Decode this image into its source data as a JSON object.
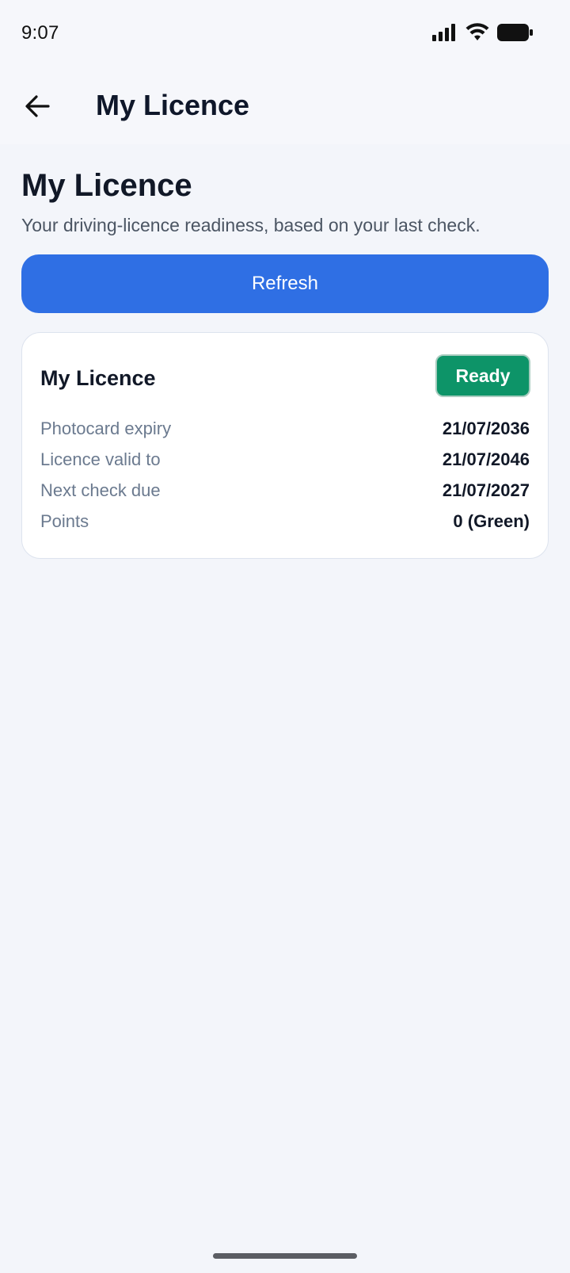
{
  "status_bar": {
    "time": "9:07",
    "icons": [
      "signal-icon",
      "wifi-icon",
      "battery-icon"
    ]
  },
  "app_bar": {
    "back_icon": "arrow-left-icon",
    "title": "My Licence"
  },
  "page": {
    "heading": "My Licence",
    "subtitle": "Your driving-licence readiness, based on your last check.",
    "refresh_label": "Refresh"
  },
  "card": {
    "title": "My Licence",
    "status": "Ready",
    "rows": [
      {
        "label": "Photocard expiry",
        "value": "21/07/2036"
      },
      {
        "label": "Licence valid to",
        "value": "21/07/2046"
      },
      {
        "label": "Next check due",
        "value": "21/07/2027"
      },
      {
        "label": "Points",
        "value": "0 (Green)"
      }
    ]
  },
  "colors": {
    "accent": "#2f6fe4",
    "status_ready": "#0d9468",
    "background": "#f3f5fa"
  }
}
